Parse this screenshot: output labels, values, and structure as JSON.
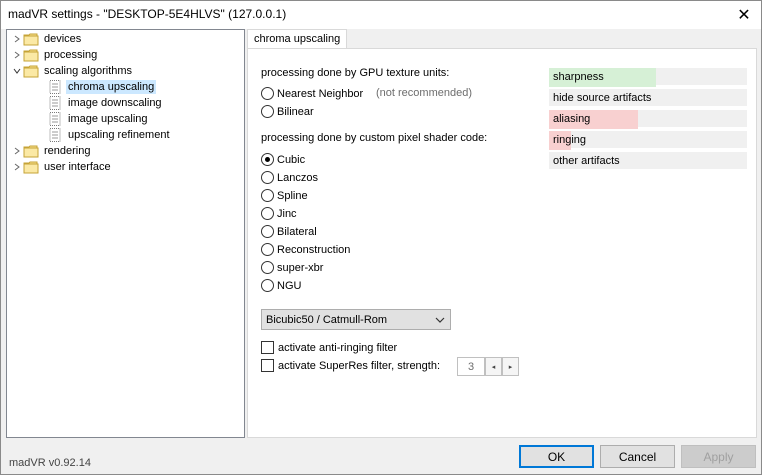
{
  "window": {
    "title": "madVR settings - \"DESKTOP-5E4HLVS\" (127.0.0.1)",
    "close_glyph": "✕"
  },
  "tree": {
    "items": [
      {
        "label": "devices",
        "icon": "folder-icon",
        "arrow": "chevron-right-icon"
      },
      {
        "label": "processing",
        "icon": "folder-icon",
        "arrow": "chevron-right-icon"
      },
      {
        "label": "scaling algorithms",
        "icon": "folder-icon",
        "arrow": "chevron-down-icon"
      },
      {
        "label": "chroma upscaling",
        "icon": "page-icon",
        "selected": true
      },
      {
        "label": "image downscaling",
        "icon": "page-icon"
      },
      {
        "label": "image upscaling",
        "icon": "page-icon"
      },
      {
        "label": "upscaling refinement",
        "icon": "page-icon"
      },
      {
        "label": "rendering",
        "icon": "folder-icon",
        "arrow": "chevron-right-icon"
      },
      {
        "label": "user interface",
        "icon": "folder-icon",
        "arrow": "chevron-right-icon"
      }
    ]
  },
  "tab": {
    "label": "chroma upscaling"
  },
  "gpu_section": {
    "heading": "processing done by GPU texture units:",
    "options": [
      {
        "label": "Nearest Neighbor",
        "note": "(not recommended)",
        "checked": false
      },
      {
        "label": "Bilinear",
        "checked": false
      }
    ]
  },
  "shader_section": {
    "heading": "processing done by custom pixel shader code:",
    "options": [
      {
        "label": "Cubic",
        "checked": true
      },
      {
        "label": "Lanczos",
        "checked": false
      },
      {
        "label": "Spline",
        "checked": false
      },
      {
        "label": "Jinc",
        "checked": false
      },
      {
        "label": "Bilateral",
        "checked": false
      },
      {
        "label": "Reconstruction",
        "checked": false
      },
      {
        "label": "super-xbr",
        "checked": false
      },
      {
        "label": "NGU",
        "checked": false
      }
    ]
  },
  "dropdown": {
    "value": "Bicubic50 / Catmull-Rom"
  },
  "checkboxes": {
    "anti_ringing": {
      "label": "activate anti-ringing filter",
      "checked": false
    },
    "superres": {
      "label": "activate SuperRes filter, strength:",
      "checked": false
    }
  },
  "strength": {
    "value": "3",
    "left_glyph": "◂",
    "right_glyph": "▸"
  },
  "quality": {
    "items": [
      {
        "label": "sharpness",
        "fraction": 0.54,
        "color": "#d6f0d6"
      },
      {
        "label": "hide source artifacts",
        "fraction": 0.0,
        "color": "#f8d0d0"
      },
      {
        "label": "aliasing",
        "fraction": 0.45,
        "color": "#f8d0d0"
      },
      {
        "label": "ringing",
        "fraction": 0.11,
        "color": "#f8d0d0"
      },
      {
        "label": "other artifacts",
        "fraction": 0.0,
        "color": "#f8d0d0"
      }
    ]
  },
  "footer": {
    "version": "madVR v0.92.14",
    "ok": "OK",
    "cancel": "Cancel",
    "apply": "Apply"
  }
}
